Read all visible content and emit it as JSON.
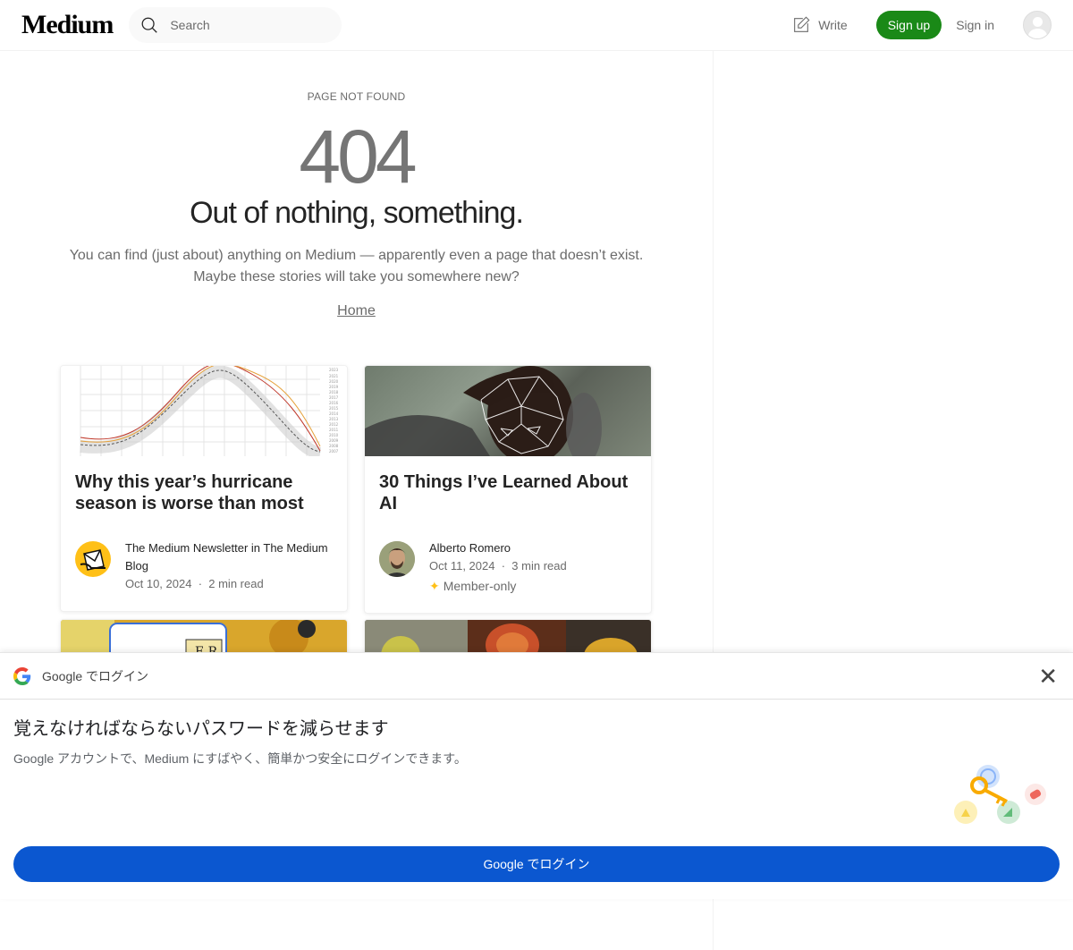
{
  "header": {
    "logo": "Medium",
    "search_placeholder": "Search",
    "write_label": "Write",
    "signup_label": "Sign up",
    "signin_label": "Sign in"
  },
  "notfound": {
    "eyebrow": "PAGE NOT FOUND",
    "code": "404",
    "headline": "Out of nothing, something.",
    "desc_line1": "You can find (just about) anything on Medium — apparently even a page that doesn’t exist.",
    "desc_line2": "Maybe these stories will take you somewhere new?",
    "home_link": "Home"
  },
  "cards": [
    {
      "title": "Why this year’s hurricane season is worse than most",
      "author": "The Medium Newsletter in The Medium Blog",
      "date": "Oct 10, 2024",
      "read_time": "2 min read"
    },
    {
      "title": "30 Things I’ve Learned About AI",
      "author": "Alberto Romero",
      "date": "Oct 11, 2024",
      "read_time": "3 min read",
      "badge": "Member-only"
    }
  ],
  "google_prompt": {
    "title": "Google でログイン",
    "headline": "覚えなければならないパスワードを減らせます",
    "subtext": "Google アカウントで、Medium にすばやく、簡単かつ安全にログインできます。",
    "button_label": "Google でログイン"
  },
  "colors": {
    "signup_green": "#1a8917",
    "google_blue": "#0b57d0",
    "member_star": "#ffc017"
  }
}
